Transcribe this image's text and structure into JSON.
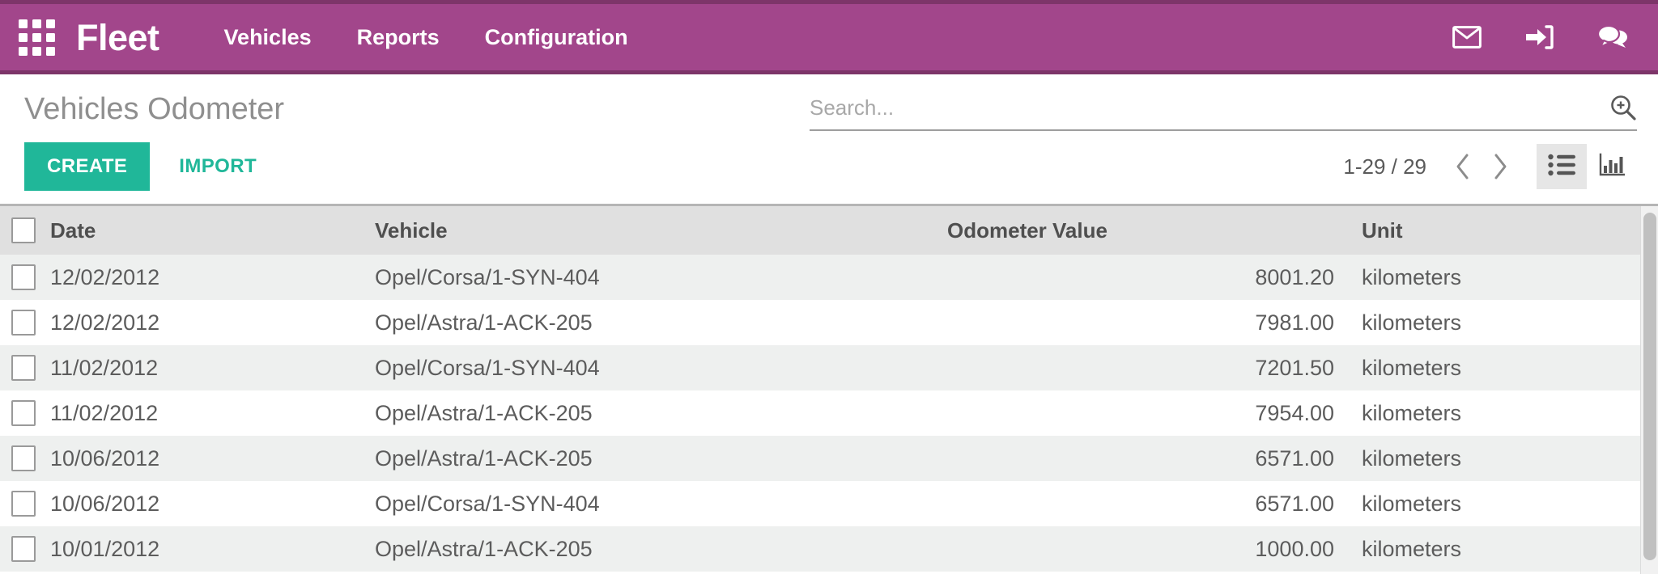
{
  "navbar": {
    "apps_icon": "apps-grid-icon",
    "brand": "Fleet",
    "menu": [
      {
        "label": "Vehicles"
      },
      {
        "label": "Reports"
      },
      {
        "label": "Configuration"
      }
    ],
    "right_icons": [
      {
        "name": "mail-icon"
      },
      {
        "name": "sign-in-icon"
      },
      {
        "name": "chat-icon"
      }
    ],
    "brand_color": "#a2468b",
    "brand_border_color": "#7d3569"
  },
  "control_panel": {
    "page_title": "Vehicles Odometer",
    "search": {
      "value": "",
      "placeholder": "Search...",
      "icon": "search-zoom-icon"
    },
    "create_label": "CREATE",
    "import_label": "IMPORT",
    "accent_color": "#20b799",
    "pager": {
      "count": "1-29 / 29",
      "prev_icon": "chevron-left-icon",
      "next_icon": "chevron-right-icon"
    },
    "views": [
      {
        "name": "list-view",
        "icon": "list-icon",
        "active": true
      },
      {
        "name": "graph-view",
        "icon": "bar-chart-icon",
        "active": false
      }
    ]
  },
  "table": {
    "columns": [
      "Date",
      "Vehicle",
      "Odometer Value",
      "Unit"
    ],
    "rows": [
      {
        "date": "12/02/2012",
        "vehicle": "Opel/Corsa/1-SYN-404",
        "odometer": "8001.20",
        "unit": "kilometers"
      },
      {
        "date": "12/02/2012",
        "vehicle": "Opel/Astra/1-ACK-205",
        "odometer": "7981.00",
        "unit": "kilometers"
      },
      {
        "date": "11/02/2012",
        "vehicle": "Opel/Corsa/1-SYN-404",
        "odometer": "7201.50",
        "unit": "kilometers"
      },
      {
        "date": "11/02/2012",
        "vehicle": "Opel/Astra/1-ACK-205",
        "odometer": "7954.00",
        "unit": "kilometers"
      },
      {
        "date": "10/06/2012",
        "vehicle": "Opel/Astra/1-ACK-205",
        "odometer": "6571.00",
        "unit": "kilometers"
      },
      {
        "date": "10/06/2012",
        "vehicle": "Opel/Corsa/1-SYN-404",
        "odometer": "6571.00",
        "unit": "kilometers"
      },
      {
        "date": "10/01/2012",
        "vehicle": "Opel/Astra/1-ACK-205",
        "odometer": "1000.00",
        "unit": "kilometers"
      }
    ]
  }
}
